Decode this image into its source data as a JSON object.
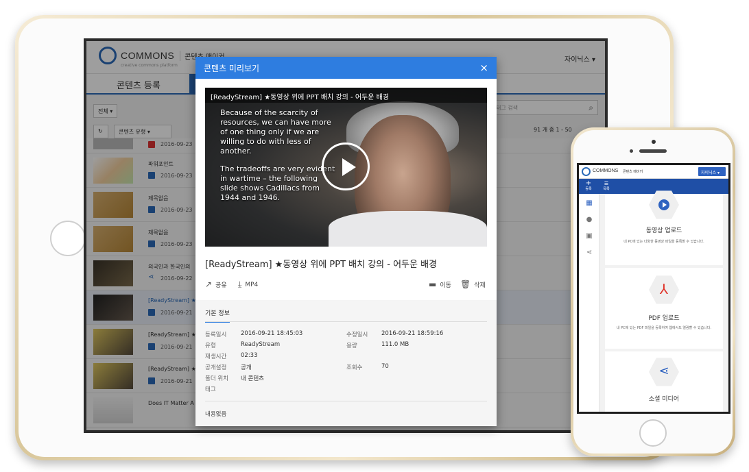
{
  "tablet_app": {
    "logo_text": "COMMONS",
    "logo_sub": "creative commons platform",
    "app_name": "콘텐츠 매이커",
    "user": "자이닉스 ▾",
    "tab_label": "콘텐츠 등록",
    "filter_all": "전체 ▾",
    "filter_type": "콘텐츠 유형 ▾",
    "search_placeholder": "태그 검색",
    "paging": "91 개 중 1 - 50",
    "rows": [
      {
        "title": "",
        "date": "2016-09-23"
      },
      {
        "title": "파워포인트",
        "date": "2016-09-23"
      },
      {
        "title": "제목없음",
        "date": "2016-09-23"
      },
      {
        "title": "제목없음",
        "date": "2016-09-23"
      },
      {
        "title": "외국인과 한국인의",
        "date": "2016-09-22"
      },
      {
        "title": "[ReadyStream] ★",
        "date": "2016-09-21"
      },
      {
        "title": "[ReadyStream] ★",
        "date": "2016-09-21"
      },
      {
        "title": "[ReadyStream] ★",
        "date": "2016-09-21"
      },
      {
        "title": "Does IT Matter A",
        "date": ""
      }
    ]
  },
  "modal": {
    "title": "콘텐츠 미리보기",
    "close": "×",
    "video_title": "[ReadyStream] ★동영상 위에 PPT 배치 강의 - 어두운 배경",
    "video_text_1": "Because of the scarcity of resources, we can have more of one thing only if we are willing to do with less of another.",
    "video_text_2": "The tradeoffs are very evident in wartime – the following slide shows Cadillacs from 1944 and 1946.",
    "content_title": "[ReadyStream] ★동영상 위에 PPT 배치 강의 - 어두운 배경",
    "actions": {
      "share": "공유",
      "download": "MP4",
      "move": "이동",
      "delete": "삭제"
    },
    "info_tab": "기본 정보",
    "info": {
      "reg_label": "등록일시",
      "reg_value": "2016-09-21 18:45:03",
      "mod_label": "수정일시",
      "mod_value": "2016-09-21 18:59:16",
      "type_label": "유형",
      "type_value": "ReadyStream",
      "size_label": "용량",
      "size_value": "111.0 MB",
      "play_label": "재생시간",
      "play_value": "02:33",
      "public_label": "공개설정",
      "public_value": "공개",
      "views_label": "조회수",
      "views_value": "70",
      "folder_label": "폴더 위치",
      "folder_value": "내 콘텐츠",
      "tag_label": "태그"
    },
    "description": "내용없음"
  },
  "phone_app": {
    "logo_text": "COMMONS",
    "app_name": "콘텐츠 매이커",
    "user": "자이닉스 ▾",
    "nav_add": "등록",
    "nav_list": "목록",
    "cards": [
      {
        "title": "동영상 업로드",
        "desc": "내 PC에 있는 다양한 동영상 파일을 등록할 수 있습니다."
      },
      {
        "title": "PDF 업로드",
        "desc": "내 PC에 있는 PDF 파일을 등록하여 웹에서도 열람할 수 있습니다."
      },
      {
        "title": "소셜 미디어",
        "desc": ""
      }
    ]
  },
  "colors": {
    "accent": "#2e7de0",
    "nav": "#1f4fa6",
    "pdf_red": "#e0352b"
  }
}
